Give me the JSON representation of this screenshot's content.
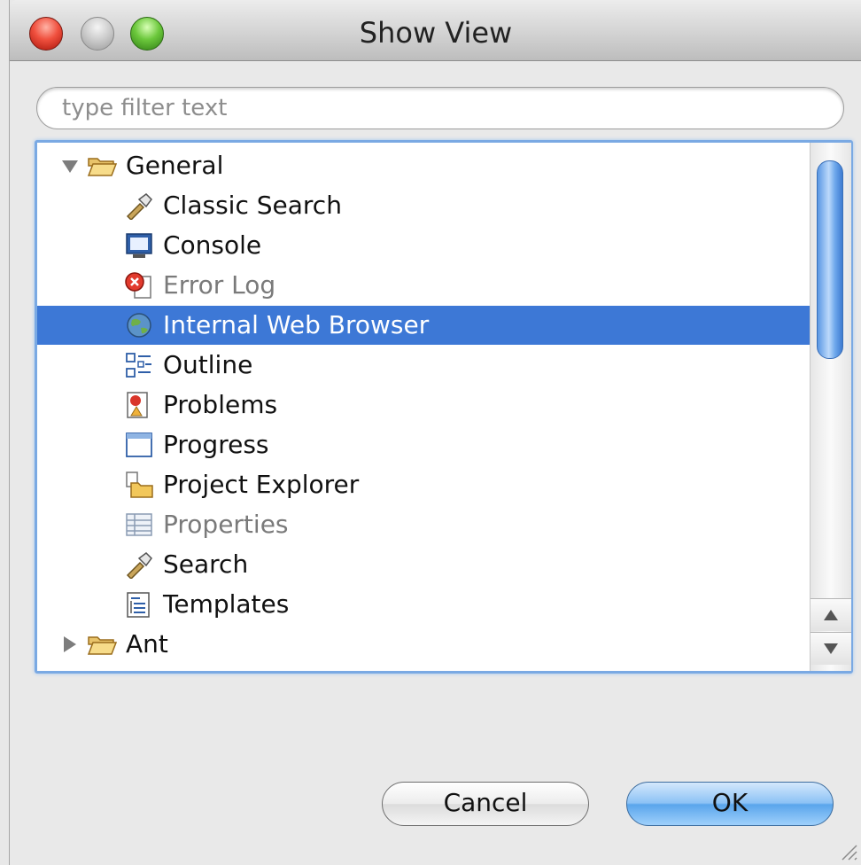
{
  "window": {
    "title": "Show View"
  },
  "filter": {
    "placeholder": "type filter text",
    "value": ""
  },
  "tree": {
    "general_label": "General",
    "general_items": [
      {
        "label": "Classic Search",
        "icon": "flashlight-icon"
      },
      {
        "label": "Console",
        "icon": "console-icon"
      },
      {
        "label": "Error Log",
        "icon": "error-log-icon",
        "disabled": true
      },
      {
        "label": "Internal Web Browser",
        "icon": "globe-icon",
        "selected": true
      },
      {
        "label": "Outline",
        "icon": "outline-icon"
      },
      {
        "label": "Problems",
        "icon": "problems-icon"
      },
      {
        "label": "Progress",
        "icon": "progress-icon"
      },
      {
        "label": "Project Explorer",
        "icon": "project-explorer-icon"
      },
      {
        "label": "Properties",
        "icon": "properties-icon",
        "disabled": true
      },
      {
        "label": "Search",
        "icon": "flashlight-icon"
      },
      {
        "label": "Templates",
        "icon": "templates-icon"
      }
    ],
    "ant_label": "Ant"
  },
  "buttons": {
    "cancel": "Cancel",
    "ok": "OK"
  },
  "colors": {
    "selection": "#3d78d6",
    "focus_ring": "#7aa9e3",
    "default_button": "#5aa5ec"
  }
}
